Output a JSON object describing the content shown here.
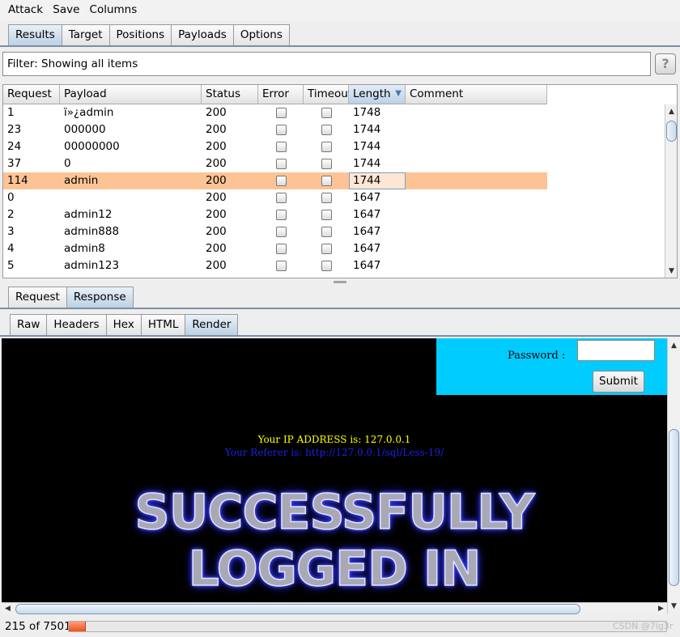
{
  "menu": [
    "Attack",
    "Save",
    "Columns"
  ],
  "main_tabs": [
    {
      "label": "Results",
      "selected": true
    },
    {
      "label": "Target",
      "selected": false
    },
    {
      "label": "Positions",
      "selected": false
    },
    {
      "label": "Payloads",
      "selected": false
    },
    {
      "label": "Options",
      "selected": false
    }
  ],
  "filter": {
    "text": "Filter: Showing all items",
    "help_label": "?"
  },
  "results": {
    "columns": [
      "Request",
      "Payload",
      "Status",
      "Error",
      "Timeout",
      "Length",
      "Comment"
    ],
    "sorted_column": "Length",
    "rows": [
      {
        "request": "1",
        "payload": "ï»¿admin",
        "status": "200",
        "error": false,
        "timeout": false,
        "length": "1748",
        "comment": "",
        "selected": false
      },
      {
        "request": "23",
        "payload": "000000",
        "status": "200",
        "error": false,
        "timeout": false,
        "length": "1744",
        "comment": "",
        "selected": false
      },
      {
        "request": "24",
        "payload": "00000000",
        "status": "200",
        "error": false,
        "timeout": false,
        "length": "1744",
        "comment": "",
        "selected": false
      },
      {
        "request": "37",
        "payload": "0",
        "status": "200",
        "error": false,
        "timeout": false,
        "length": "1744",
        "comment": "",
        "selected": false
      },
      {
        "request": "114",
        "payload": "admin",
        "status": "200",
        "error": false,
        "timeout": false,
        "length": "1744",
        "comment": "",
        "selected": true
      },
      {
        "request": "0",
        "payload": "",
        "status": "200",
        "error": false,
        "timeout": false,
        "length": "1647",
        "comment": "",
        "selected": false
      },
      {
        "request": "2",
        "payload": "admin12",
        "status": "200",
        "error": false,
        "timeout": false,
        "length": "1647",
        "comment": "",
        "selected": false
      },
      {
        "request": "3",
        "payload": "admin888",
        "status": "200",
        "error": false,
        "timeout": false,
        "length": "1647",
        "comment": "",
        "selected": false
      },
      {
        "request": "4",
        "payload": "admin8",
        "status": "200",
        "error": false,
        "timeout": false,
        "length": "1647",
        "comment": "",
        "selected": false
      },
      {
        "request": "5",
        "payload": "admin123",
        "status": "200",
        "error": false,
        "timeout": false,
        "length": "1647",
        "comment": "",
        "selected": false
      }
    ]
  },
  "message_tabs": [
    {
      "label": "Request",
      "selected": false
    },
    {
      "label": "Response",
      "selected": true
    }
  ],
  "view_tabs": [
    {
      "label": "Raw",
      "selected": false
    },
    {
      "label": "Headers",
      "selected": false
    },
    {
      "label": "Hex",
      "selected": false
    },
    {
      "label": "HTML",
      "selected": false
    },
    {
      "label": "Render",
      "selected": true
    }
  ],
  "render": {
    "password_label": "Password :",
    "password_value": "",
    "submit_label": "Submit",
    "ip_text": "Your IP ADDRESS is: 127.0.0.1",
    "referer_text": "Your Referer is: http://127.0.0.1/sql/Less-19/",
    "success_line1": "SUCCESSFULLY",
    "success_line2": "LOGGED IN"
  },
  "footer": {
    "count_text": "215 of 7501",
    "progress_fraction": 0.0287,
    "watermark": "CSDN @7ig3r"
  },
  "colors": {
    "selected_row": "#fcc495",
    "login_box": "#00ccff",
    "ip_text": "#ffff00",
    "referer_text": "#1a22dd",
    "progress": "#f0501e"
  },
  "icons": {
    "sort": "sort-descending-icon",
    "scroll_up": "arrow-up-icon",
    "scroll_down": "arrow-down-icon",
    "scroll_left": "arrow-left-icon",
    "scroll_right": "arrow-right-icon"
  }
}
